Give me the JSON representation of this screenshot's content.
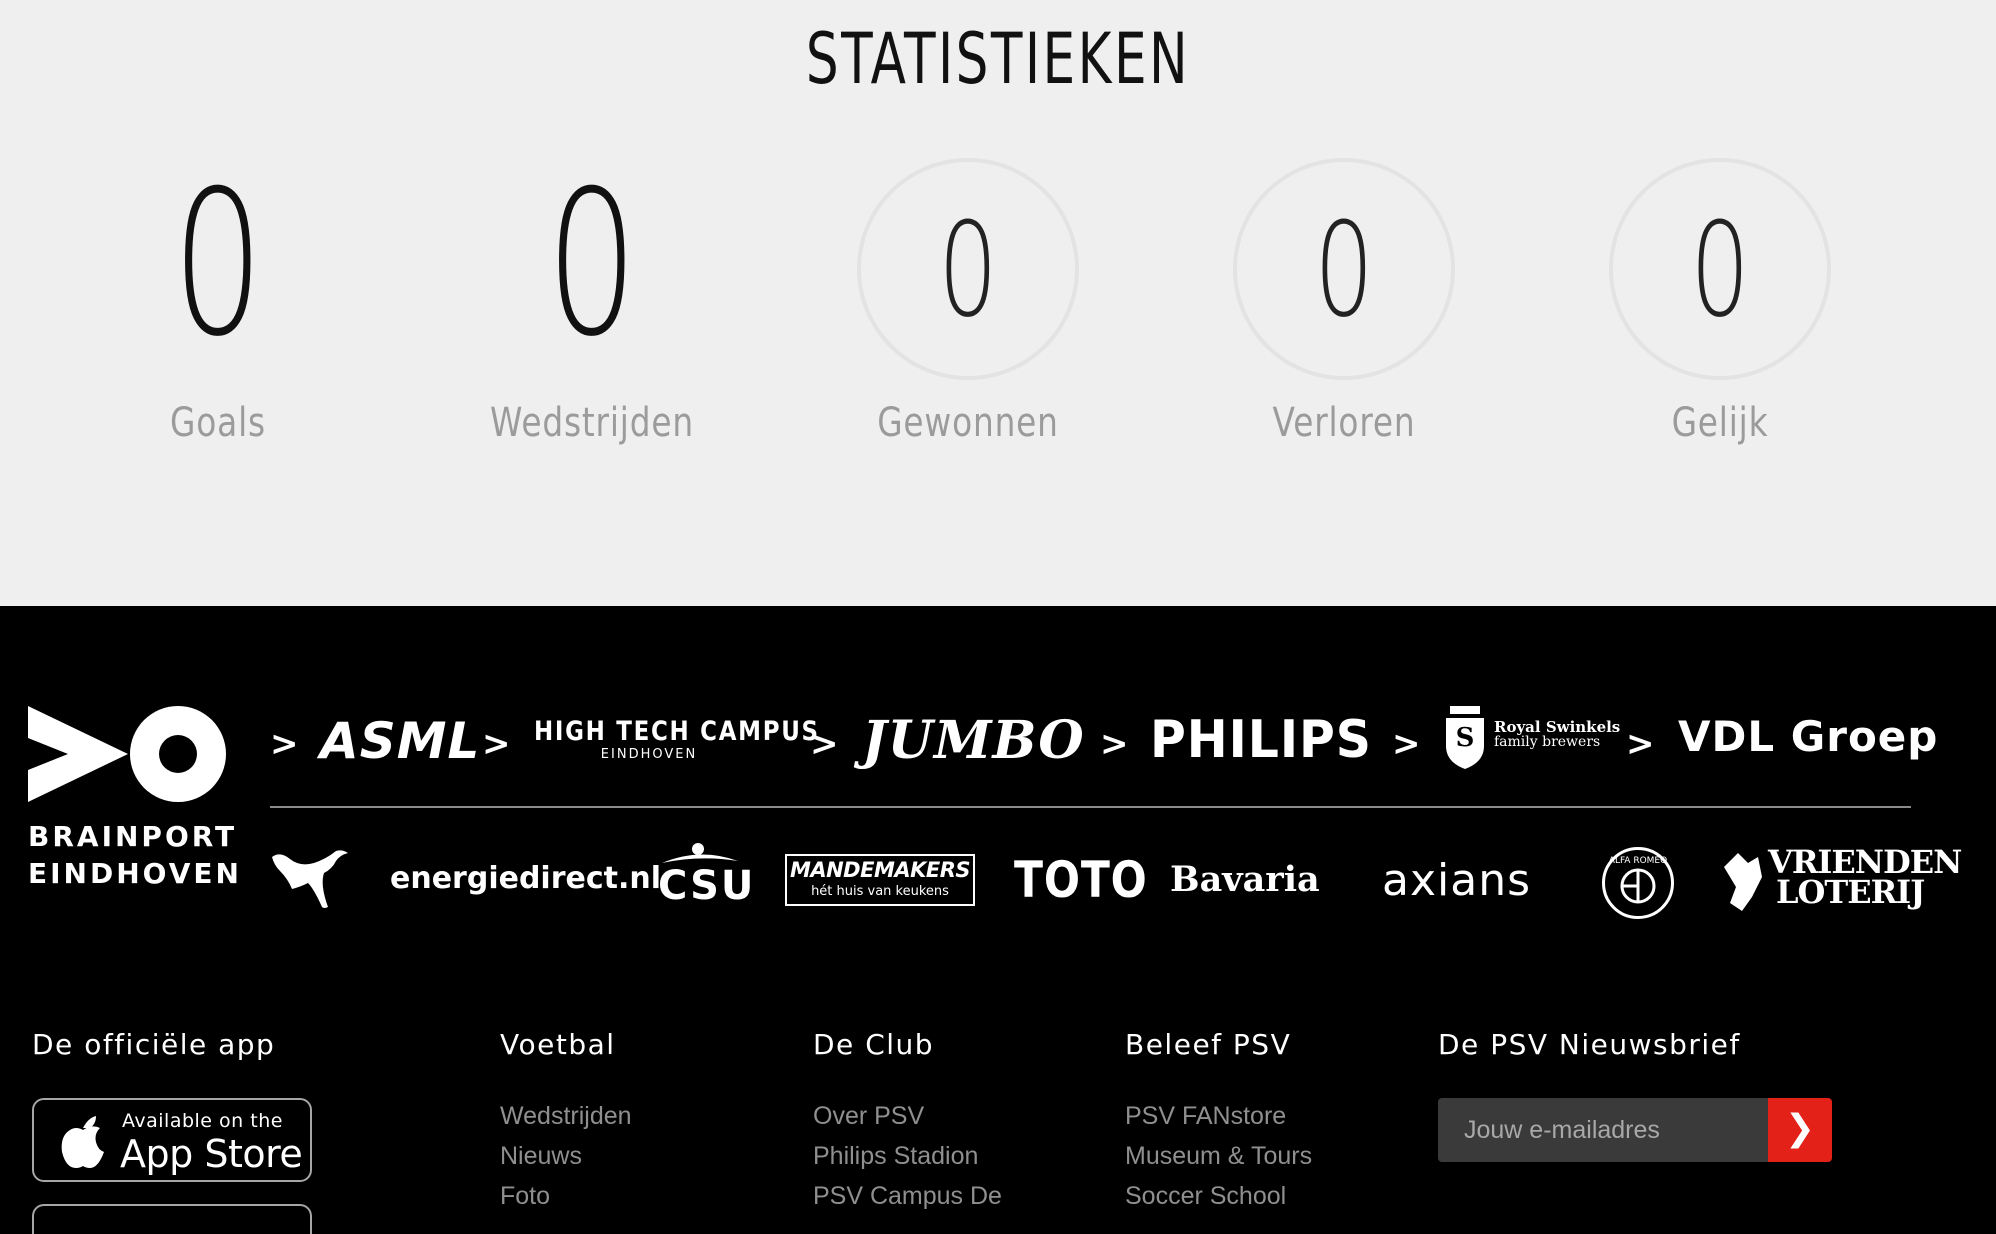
{
  "stats": {
    "title": "STATISTIEKEN",
    "items": [
      {
        "value": "0",
        "label": "Goals"
      },
      {
        "value": "0",
        "label": "Wedstrijden"
      },
      {
        "value": "0",
        "label": "Gewonnen"
      },
      {
        "value": "0",
        "label": "Verloren"
      },
      {
        "value": "0",
        "label": "Gelijk"
      }
    ]
  },
  "sponsors": {
    "brainport": {
      "line1": "BRAINPORT",
      "line2": "EINDHOVEN"
    },
    "row1": [
      "ASML",
      "HIGH TECH CAMPUS",
      "EINDHOVEN",
      "JUMBO",
      "PHILIPS",
      "Royal Swinkels",
      "family brewers",
      "VDL Groep"
    ],
    "row2": [
      "energiedirect.nl",
      "CSU",
      "MANDEMAKERS",
      "hét huis van keukens",
      "TOTO",
      "Bavaria",
      "axians",
      "ALFA ROMEO",
      "VRIENDEN",
      "LOTERIJ"
    ]
  },
  "footer": {
    "app": {
      "title": "De officiële app",
      "available": "Available on the",
      "store": "App Store"
    },
    "voetbal": {
      "title": "Voetbal",
      "links": [
        "Wedstrijden",
        "Nieuws",
        "Foto"
      ]
    },
    "club": {
      "title": "De Club",
      "links": [
        "Over PSV",
        "Philips Stadion",
        "PSV Campus De"
      ]
    },
    "beleef": {
      "title": "Beleef PSV",
      "links": [
        "PSV FANstore",
        "Museum & Tours",
        "Soccer School"
      ]
    },
    "newsletter": {
      "title": "De PSV Nieuwsbrief",
      "placeholder": "Jouw e-mailadres",
      "submit": "❯"
    }
  }
}
